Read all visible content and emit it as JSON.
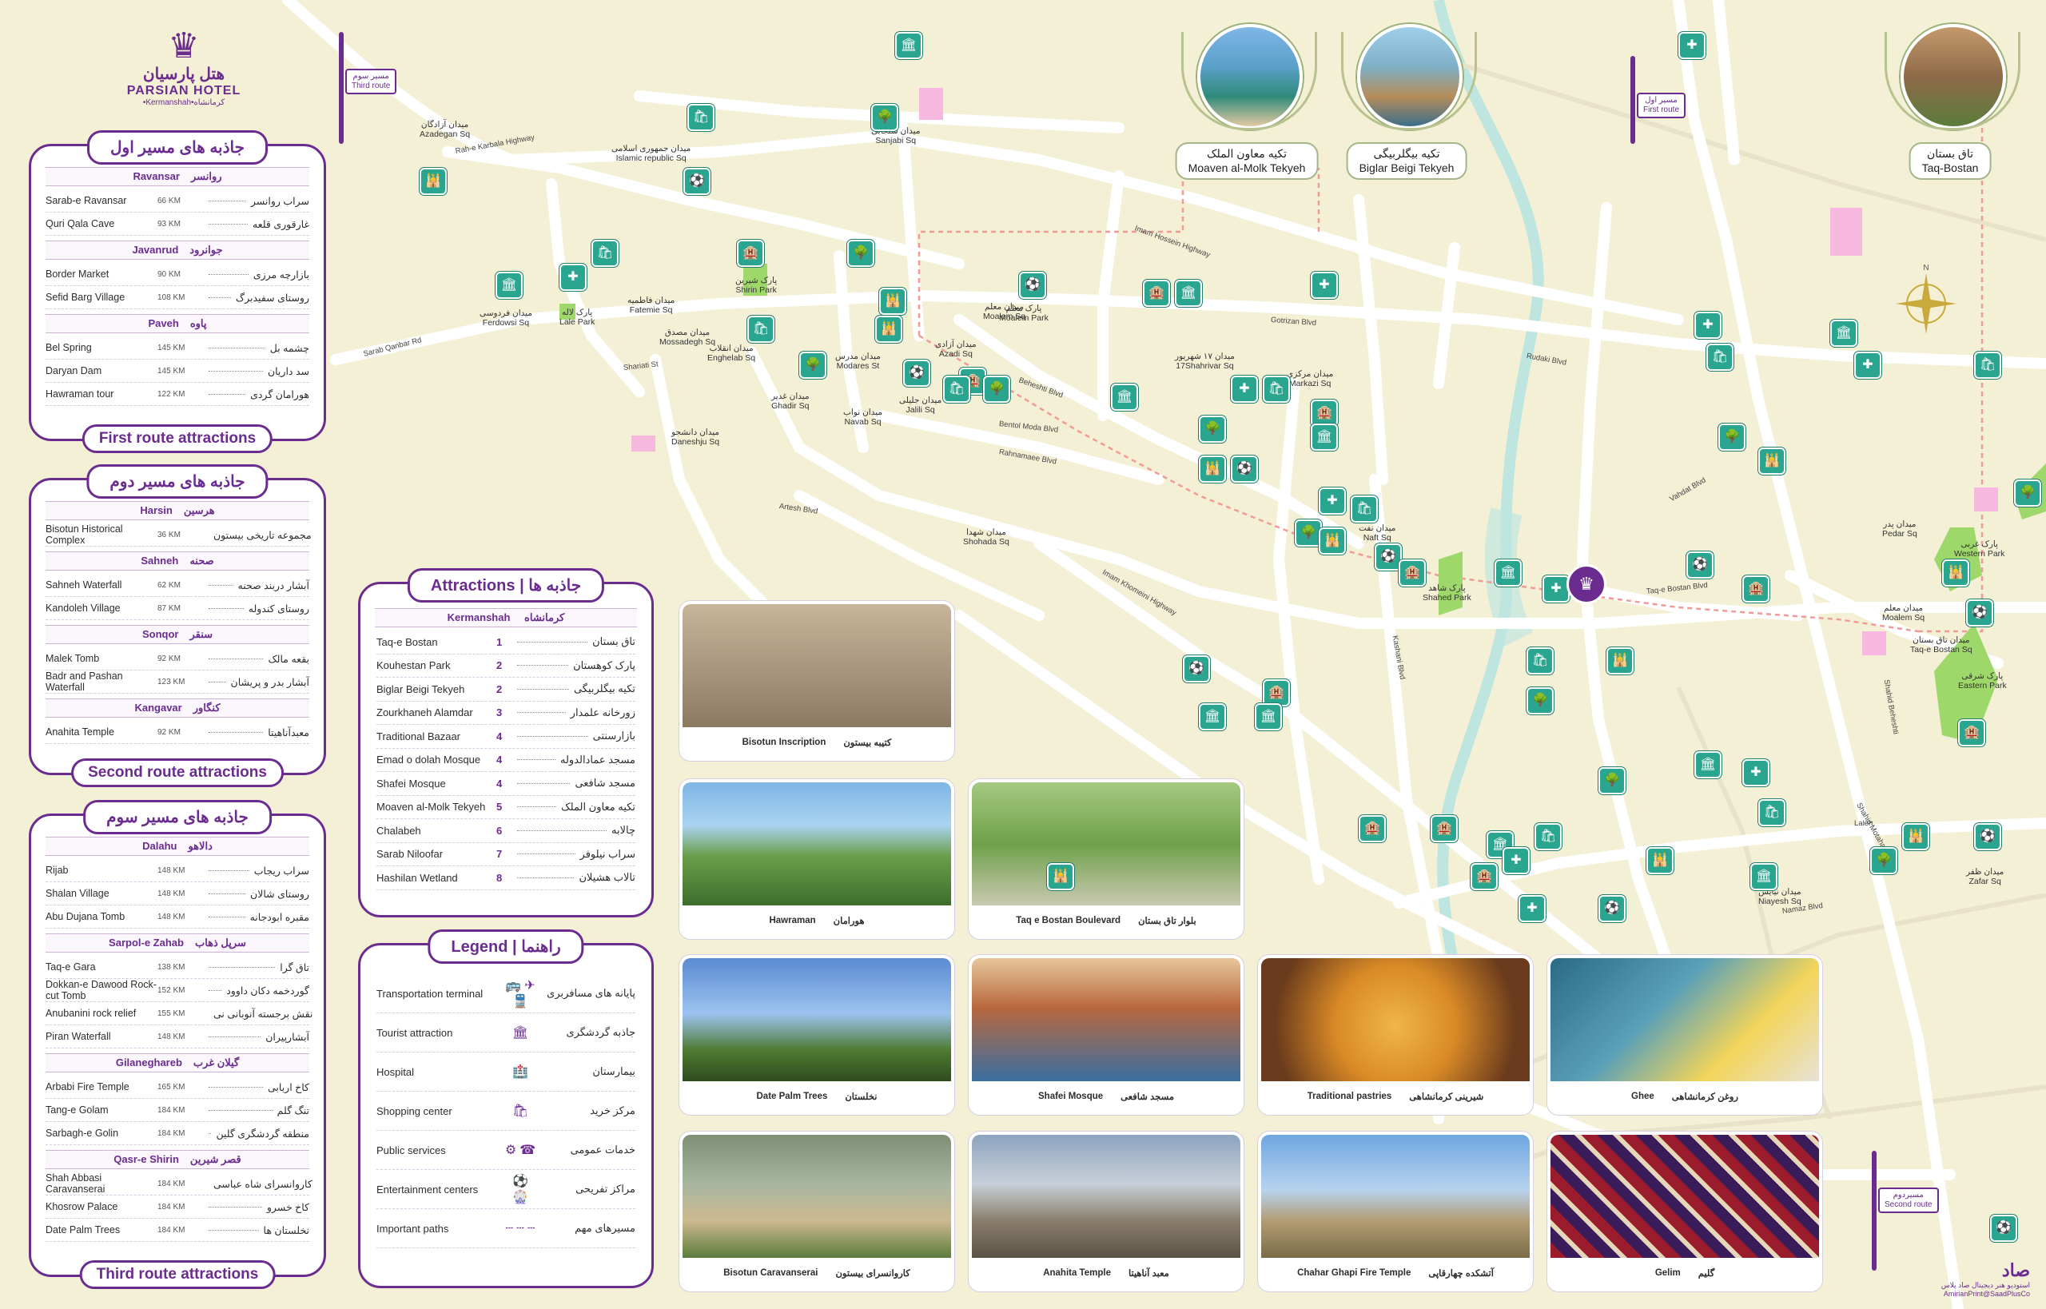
{
  "hotel": {
    "name_fa": "هتل پارسیان",
    "name_en": "PARSIAN HOTEL",
    "sub": "•Kermanshah•کرمانشاه",
    "icon": "hotel-crown-icon"
  },
  "colors": {
    "brand": "#6b2c8f",
    "pin": "#2aa58f",
    "park": "#9fd86a",
    "road": "#ffffff",
    "river": "#bfe5e0",
    "background": "#f4f0d6"
  },
  "route_panels": [
    {
      "title_fa": "جاذبه های مسیر اول",
      "footer_en": "First route attractions",
      "groups": [
        {
          "en": "Ravansar",
          "fa": "روانسر",
          "rows": [
            {
              "en": "Sarab-e Ravansar",
              "km": "66 KM",
              "fa": "سراب روانسر"
            },
            {
              "en": "Quri Qala Cave",
              "km": "93 KM",
              "fa": "غارقوری قلعه"
            }
          ]
        },
        {
          "en": "Javanrud",
          "fa": "جوانرود",
          "rows": [
            {
              "en": "Border Market",
              "km": "90 KM",
              "fa": "بازارچه مرزی"
            },
            {
              "en": "Sefid Barg Village",
              "km": "108 KM",
              "fa": "روستای سفیدبرگ"
            }
          ]
        },
        {
          "en": "Paveh",
          "fa": "پاوه",
          "rows": [
            {
              "en": "Bel Spring",
              "km": "145 KM",
              "fa": "چشمه بل"
            },
            {
              "en": "Daryan Dam",
              "km": "145 KM",
              "fa": "سد داریان"
            },
            {
              "en": "Hawraman tour",
              "km": "122 KM",
              "fa": "هورامان گردی"
            }
          ]
        }
      ]
    },
    {
      "title_fa": "جاذبه های مسیر دوم",
      "footer_en": "Second route attractions",
      "groups": [
        {
          "en": "Harsin",
          "fa": "هرسین",
          "rows": [
            {
              "en": "Bisotun Historical Complex",
              "km": "36 KM",
              "fa": "مجموعه تاریخی بیستون"
            }
          ]
        },
        {
          "en": "Sahneh",
          "fa": "صحنه",
          "rows": [
            {
              "en": "Sahneh Waterfall",
              "km": "62 KM",
              "fa": "آبشار دربند صحنه"
            },
            {
              "en": "Kandoleh Village",
              "km": "87 KM",
              "fa": "روستای کندوله"
            }
          ]
        },
        {
          "en": "Sonqor",
          "fa": "سنقر",
          "rows": [
            {
              "en": "Malek Tomb",
              "km": "92 KM",
              "fa": "بقعه مالک"
            },
            {
              "en": "Badr and Pashan Waterfall",
              "km": "123 KM",
              "fa": "آبشار بدر و پریشان"
            }
          ]
        },
        {
          "en": "Kangavar",
          "fa": "کنگاور",
          "rows": [
            {
              "en": "Anahita Temple",
              "km": "92 KM",
              "fa": "معبدآناهیتا"
            }
          ]
        }
      ]
    },
    {
      "title_fa": "جاذبه های مسیر سوم",
      "footer_en": "Third route attractions",
      "groups": [
        {
          "en": "Dalahu",
          "fa": "دالاهو",
          "rows": [
            {
              "en": "Rijab",
              "km": "148 KM",
              "fa": "سراب ریجاب"
            },
            {
              "en": "Shalan Village",
              "km": "148 KM",
              "fa": "روستای شالان"
            },
            {
              "en": "Abu Dujana Tomb",
              "km": "148 KM",
              "fa": "مقبره ابودجانه"
            }
          ]
        },
        {
          "en": "Sarpol-e Zahab",
          "fa": "سرپل ذهاب",
          "rows": [
            {
              "en": "Taq-e Gara",
              "km": "138 KM",
              "fa": "تاق گرا"
            },
            {
              "en": "Dokkan-e Dawood Rock-cut Tomb",
              "km": "152 KM",
              "fa": "گوردخمه دکان داوود"
            },
            {
              "en": "Anubanini rock relief",
              "km": "155 KM",
              "fa": "نقش برجسته آنوبانی نی"
            },
            {
              "en": "Piran Waterfall",
              "km": "148 KM",
              "fa": "آبشارپیران"
            }
          ]
        },
        {
          "en": "Gilaneghareb",
          "fa": "گیلان غرب",
          "rows": [
            {
              "en": "Arbabi Fire Temple",
              "km": "165 KM",
              "fa": "کاخ اربابی"
            },
            {
              "en": "Tang-e Golam",
              "km": "184 KM",
              "fa": "تنگ گلم"
            },
            {
              "en": "Sarbagh-e Golin",
              "km": "184 KM",
              "fa": "منطقه گردشگری گلین"
            }
          ]
        },
        {
          "en": "Qasr-e Shirin",
          "fa": "قصر شیرین",
          "rows": [
            {
              "en": "Shah Abbasi Caravanserai",
              "km": "184 KM",
              "fa": "کاروانسرای شاه عباسی"
            },
            {
              "en": "Khosrow Palace",
              "km": "184 KM",
              "fa": "کاخ خسرو"
            },
            {
              "en": "Date Palm Trees",
              "km": "184 KM",
              "fa": "نخلستان ها"
            }
          ]
        }
      ]
    }
  ],
  "attractions": {
    "title_en": "Attractions",
    "title_fa": "جاذبه ها",
    "city_en": "Kermanshah",
    "city_fa": "کرمانشاه",
    "rows": [
      {
        "en": "Taq-e Bostan",
        "num": "1",
        "fa": "تاق بستان"
      },
      {
        "en": "Kouhestan Park",
        "num": "2",
        "fa": "پارک کوهستان"
      },
      {
        "en": "Biglar Beigi Tekyeh",
        "num": "2",
        "fa": "تکیه بیگلربیگی"
      },
      {
        "en": "Zourkhaneh Alamdar",
        "num": "3",
        "fa": "زورخانه علمدار"
      },
      {
        "en": "Traditional Bazaar",
        "num": "4",
        "fa": "بازارسنتی"
      },
      {
        "en": "Emad o dolah Mosque",
        "num": "4",
        "fa": "مسجد عمادالدوله"
      },
      {
        "en": "Shafei Mosque",
        "num": "4",
        "fa": "مسجد شافعی"
      },
      {
        "en": "Moaven al-Molk Tekyeh",
        "num": "5",
        "fa": "تکیه معاون الملک"
      },
      {
        "en": "Chalabeh",
        "num": "6",
        "fa": "چالابه"
      },
      {
        "en": "Sarab Niloofar",
        "num": "7",
        "fa": "سراب نیلوفر"
      },
      {
        "en": "Hashilan Wetland",
        "num": "8",
        "fa": "تالاب هشیلان"
      }
    ]
  },
  "legend": {
    "title_en": "Legend",
    "title_fa": "راهنما",
    "rows": [
      {
        "en": "Transportation terminal",
        "fa": "پایانه های مسافربری",
        "icons": "bus-plane-train-icons"
      },
      {
        "en": "Tourist attraction",
        "fa": "جاذبه گردشگری",
        "icons": "attraction-icon"
      },
      {
        "en": "Hospital",
        "fa": "بیمارستان",
        "icons": "hospital-icon"
      },
      {
        "en": "Shopping center",
        "fa": "مرکز خرید",
        "icons": "shopping-icon"
      },
      {
        "en": "Public services",
        "fa": "خدمات عمومی",
        "icons": "public-services-icons"
      },
      {
        "en": "Entertainment centers",
        "fa": "مراکز تفریحی",
        "icons": "entertainment-icons"
      },
      {
        "en": "Important paths",
        "fa": "مسیرهای مهم",
        "icons": "path-line-icon"
      }
    ]
  },
  "photos": [
    {
      "en": "Bisotun Inscription",
      "fa": "کتیبه بیستون",
      "theme": "relief"
    },
    {
      "en": "Hawraman",
      "fa": "هورامان",
      "theme": "mountain"
    },
    {
      "en": "Taq e Bostan Boulevard",
      "fa": "بلوار تاق بستان",
      "theme": "boulevard"
    },
    {
      "en": "Date Palm Trees",
      "fa": "نخلستان",
      "theme": "palms"
    },
    {
      "en": "Shafei Mosque",
      "fa": "مسجد شافعی",
      "theme": "mosque"
    },
    {
      "en": "Traditional pastries",
      "fa": "شیرینی کرمانشاهی",
      "theme": "pastry"
    },
    {
      "en": "Ghee",
      "fa": "روغن کرمانشاهی",
      "theme": "ghee"
    },
    {
      "en": "Bisotun Caravanserai",
      "fa": "کاروانسرای بیستون",
      "theme": "caravanserai"
    },
    {
      "en": "Anahita Temple",
      "fa": "معبد آناهیتا",
      "theme": "temple"
    },
    {
      "en": "Chahar Ghapi Fire Temple",
      "fa": "آتشکده چهارقاپی",
      "theme": "ruins"
    },
    {
      "en": "Gelim",
      "fa": "گلیم",
      "theme": "rug"
    }
  ],
  "medallions": [
    {
      "fa": "تکیه معاون الملک",
      "en": "Moaven al-Molk Tekyeh"
    },
    {
      "fa": "تکیه بیگلربیگی",
      "en": "Biglar Beigi Tekyeh"
    },
    {
      "fa": "تاق بستان",
      "en": "Taq-Bostan"
    }
  ],
  "route_signs": [
    {
      "fa": "مسیر سوم",
      "en": "Third route"
    },
    {
      "fa": "مسیر اول",
      "en": "First route"
    },
    {
      "fa": "مسیردوم",
      "en": "Second route"
    }
  ],
  "map_labels": {
    "squares": [
      {
        "fa": "میدان آزادگان",
        "en": "Azadegan Sq"
      },
      {
        "fa": "میدان جمهوری اسلامی",
        "en": "Islamic republic Sq"
      },
      {
        "fa": "میدان سنجابی",
        "en": "Sanjabi Sq"
      },
      {
        "fa": "میدان فردوسی",
        "en": "Ferdowsi Sq"
      },
      {
        "fa": "میدان فاطمیه",
        "en": "Fatemie Sq"
      },
      {
        "fa": "میدان مصدق",
        "en": "Mossadegh Sq"
      },
      {
        "fa": "میدان انقلاب",
        "en": "Enghelab Sq"
      },
      {
        "fa": "میدان مدرس",
        "en": "Modares St"
      },
      {
        "fa": "میدان آزادی",
        "en": "Azadi Sq"
      },
      {
        "fa": "میدان معلم",
        "en": "Moalem Sq"
      },
      {
        "fa": "میدان غدیر",
        "en": "Ghadir Sq"
      },
      {
        "fa": "میدان نواب",
        "en": "Navab Sq"
      },
      {
        "fa": "میدان جلیلی",
        "en": "Jalili Sq"
      },
      {
        "fa": "میدان دانشجو",
        "en": "Daneshju Sq"
      },
      {
        "fa": "میدان شهدا",
        "en": "Shohada Sq"
      },
      {
        "fa": "میدان ۱۷ شهریور",
        "en": "17Shahrivar Sq"
      },
      {
        "fa": "میدان مرکزی",
        "en": "Markazi Sq"
      },
      {
        "fa": "میدان نفت",
        "en": "Naft Sq"
      },
      {
        "fa": "میدان پدر",
        "en": "Pedar Sq"
      },
      {
        "fa": "میدان معلم",
        "en": "Moalem Sq"
      },
      {
        "fa": "میدان تاق بستان",
        "en": "Taq-e Bostan Sq"
      },
      {
        "fa": "میدان ظفر",
        "en": "Zafar Sq"
      },
      {
        "fa": "میدان نیایش",
        "en": "Niayesh Sq"
      }
    ],
    "parks": [
      {
        "fa": "پارک شیرین",
        "en": "Shirin Park"
      },
      {
        "fa": "پارک لاله",
        "en": "Lale Park"
      },
      {
        "fa": "پارک شاهد",
        "en": "Shahed Park"
      },
      {
        "fa": "پارک غربی",
        "en": "Western Park"
      },
      {
        "fa": "پارک شرقی",
        "en": "Eastern Park"
      },
      {
        "fa": "پارک معلم",
        "en": "Moalem Park"
      }
    ],
    "roads": [
      {
        "en": "Rah-e Karbala Highway"
      },
      {
        "en": "Imam Hossein Highway"
      },
      {
        "en": "Sarab Qanbar Rd"
      },
      {
        "en": "Shariati St"
      },
      {
        "en": "Bentol Moda Blvd"
      },
      {
        "en": "Rahnamaee Blvd"
      },
      {
        "en": "Artesh Blvd"
      },
      {
        "en": "Imam Khomeini Highway"
      },
      {
        "en": "Gotrizan Blvd"
      },
      {
        "en": "Rudaki Blvd"
      },
      {
        "en": "Taq-e Bostan Blvd"
      },
      {
        "en": "Vahdat Blvd"
      },
      {
        "en": "Namaz Blvd"
      },
      {
        "en": "Laleh"
      },
      {
        "en": "Beheshti Blvd"
      },
      {
        "en": "Kashani Blvd"
      },
      {
        "en": "Shahid Motahari"
      },
      {
        "en": "Shahid Beheshti"
      }
    ]
  },
  "credits": {
    "line1": "استودیو هنر دیجیتال صاد پلاس",
    "line2": "AmirianPrint@SaadPlusCo"
  }
}
